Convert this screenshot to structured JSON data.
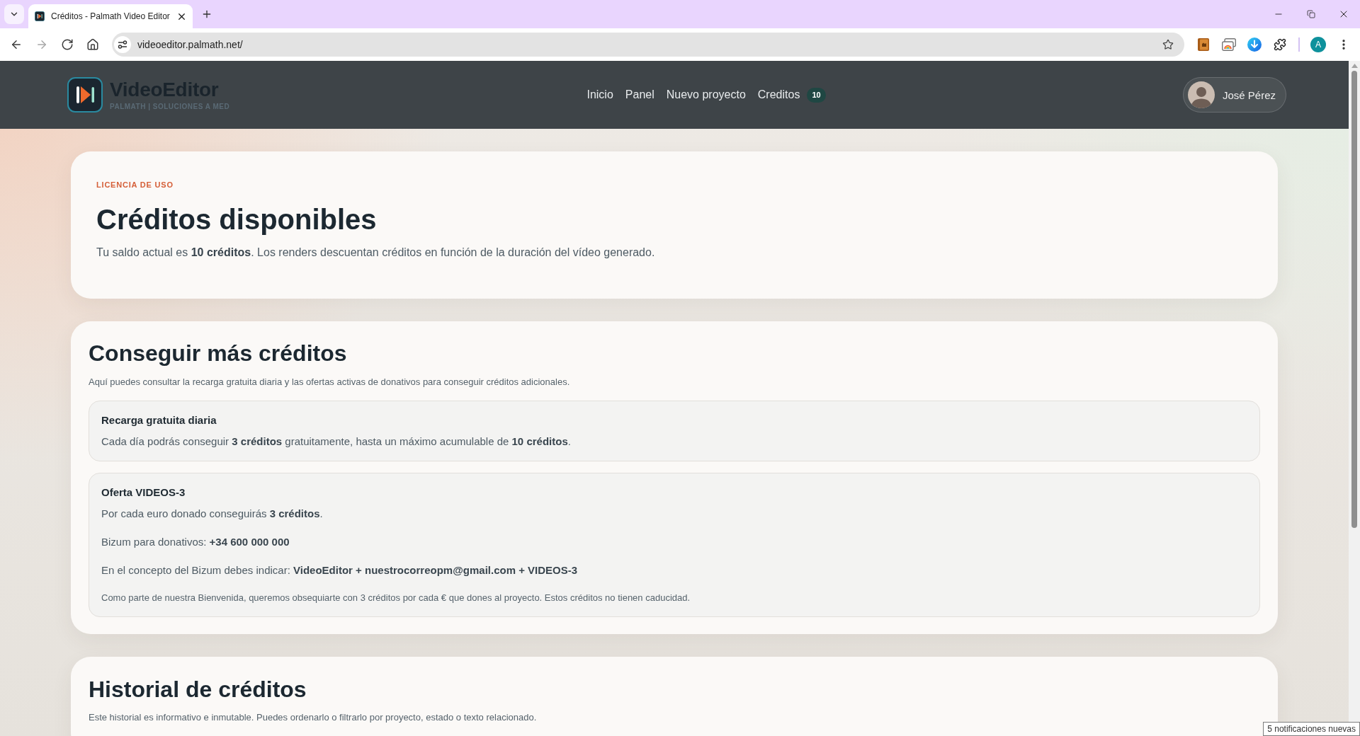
{
  "browser": {
    "tabs": [
      {
        "title": "Créditos - Palmath Video Editor",
        "selected": true
      }
    ],
    "navigation": [
      {
        "kind": "back",
        "disabled": false
      },
      {
        "kind": "forward",
        "disabled": true
      },
      {
        "kind": "reload",
        "disabled": false
      },
      {
        "kind": "home",
        "disabled": false
      }
    ],
    "url": "videoeditor.palmath.net/",
    "profile_initial": "A"
  },
  "header": {
    "brand": {
      "name": "VideoEditor",
      "tagline": "PALMATH | SOLUCIONES A MED"
    },
    "nav": [
      {
        "label": "Inicio"
      },
      {
        "label": "Panel"
      },
      {
        "label": "Nuevo proyecto"
      },
      {
        "label": "Creditos",
        "badge": "10"
      }
    ],
    "user": {
      "name": "José Pérez"
    }
  },
  "balance": {
    "eyebrow": "LICENCIA DE USO",
    "title": "Créditos disponibles",
    "text": "Tu saldo actual es **10 créditos**. Los renders descuentan créditos en función de la duración del vídeo generado."
  },
  "get_credits": {
    "title": "Conseguir más créditos",
    "description": "Aquí puedes consultar la recarga gratuita diaria y las ofertas activas de donativos para conseguir créditos adicionales.",
    "offers": [
      {
        "title": "Recarga gratuita diaria",
        "paragraphs": [
          "Cada día podrás conseguir **3 créditos** gratuitamente, hasta un máximo acumulable de **10 créditos**."
        ]
      },
      {
        "title": "Oferta VIDEOS-3",
        "paragraphs": [
          "Por cada euro donado conseguirás **3 créditos**.",
          "Bizum para donativos: **+34 600 000 000**",
          "En el concepto del Bizum debes indicar: **VideoEditor + nuestrocorreopm@gmail.com + VIDEOS-3**"
        ],
        "note": "Como parte de nuestra Bienvenida, queremos obsequiarte con 3 créditos por cada € que dones al proyecto. Estos créditos no tienen caducidad."
      }
    ]
  },
  "history": {
    "title": "Historial de créditos",
    "description": "Este historial es informativo e inmutable. Puedes ordenarlo o filtrarlo por proyecto, estado o texto relacionado."
  },
  "notification": "5 notificaciones nuevas"
}
